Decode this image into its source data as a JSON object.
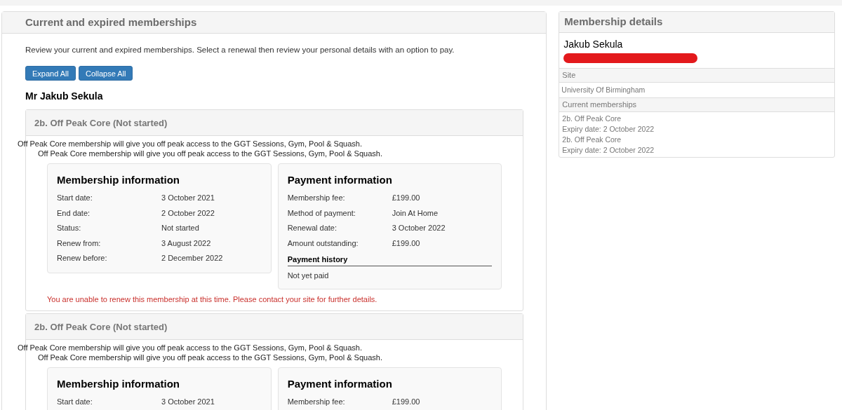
{
  "main": {
    "title": "Current and expired memberships",
    "intro": "Review your current and expired memberships. Select a renewal then review your personal details with an option to pay.",
    "buttons": [
      "Expand All",
      "Collapse All"
    ],
    "member_name": "Mr Jakub Sekula",
    "memberships": [
      {
        "title": "2b. Off Peak Core (Not started)",
        "description": [
          "Off Peak Core membership will give you off peak access to the GGT Sessions, Gym, Pool & Squash.",
          "Off Peak Core membership will give you off peak access to the GGT Sessions, Gym, Pool & Squash."
        ],
        "membership_information": {
          "title": "Membership information",
          "rows": [
            {
              "label": "Start date:",
              "value": "3 October 2021"
            },
            {
              "label": "End date:",
              "value": "2 October 2022"
            },
            {
              "label": "Status:",
              "value": "Not started"
            },
            {
              "label": "Renew from:",
              "value": "3 August 2022"
            },
            {
              "label": "Renew before:",
              "value": "2 December 2022"
            }
          ]
        },
        "payment_information": {
          "title": "Payment information",
          "rows": [
            {
              "label": "Membership fee:",
              "value": "£199.00"
            },
            {
              "label": "Method of payment:",
              "value": "Join At Home"
            },
            {
              "label": "Renewal date:",
              "value": "3 October 2022"
            },
            {
              "label": "Amount outstanding:",
              "value": "£199.00"
            }
          ],
          "history_title": "Payment history",
          "history": "Not yet paid"
        },
        "warning": "You are unable to renew this membership at this time. Please contact your site for further details."
      },
      {
        "title": "2b. Off Peak Core (Not started)",
        "description": [
          "Off Peak Core membership will give you off peak access to the GGT Sessions, Gym, Pool & Squash.",
          "Off Peak Core membership will give you off peak access to the GGT Sessions, Gym, Pool & Squash."
        ],
        "membership_information": {
          "title": "Membership information",
          "rows": [
            {
              "label": "Start date:",
              "value": "3 October 2021"
            }
          ]
        },
        "payment_information": {
          "title": "Payment information",
          "rows": [
            {
              "label": "Membership fee:",
              "value": "£199.00"
            }
          ]
        }
      }
    ]
  },
  "details": {
    "title": "Membership details",
    "name": "Jakub Sekula",
    "site_label": "Site",
    "site": "University Of Birmingham",
    "current_label": "Current memberships",
    "current": [
      {
        "name": "2b. Off Peak Core",
        "expiry": "Expiry date: 2 October 2022"
      },
      {
        "name": "2b. Off Peak Core",
        "expiry": "Expiry date: 2 October 2022"
      }
    ]
  }
}
